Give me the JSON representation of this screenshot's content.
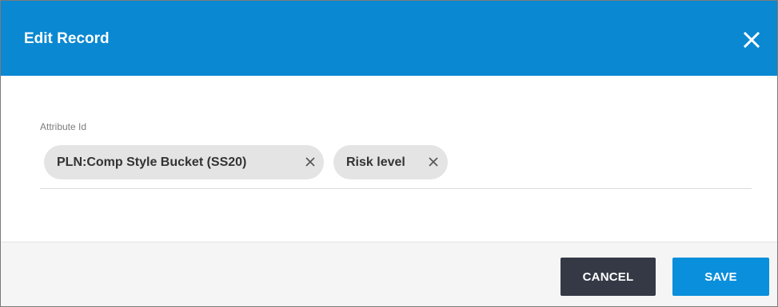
{
  "dialog": {
    "title": "Edit Record"
  },
  "field": {
    "label": "Attribute Id",
    "chips": [
      {
        "label": "PLN:Comp Style Bucket (SS20)"
      },
      {
        "label": "Risk level"
      }
    ]
  },
  "footer": {
    "cancel_label": "CANCEL",
    "save_label": "SAVE"
  },
  "colors": {
    "header_bg": "#0a88d2",
    "cancel_bg": "#343945",
    "save_bg": "#0a8fdc",
    "chip_bg": "#e4e4e4"
  },
  "icons": {
    "close": "close-icon",
    "chip_remove": "remove-chip-icon"
  }
}
